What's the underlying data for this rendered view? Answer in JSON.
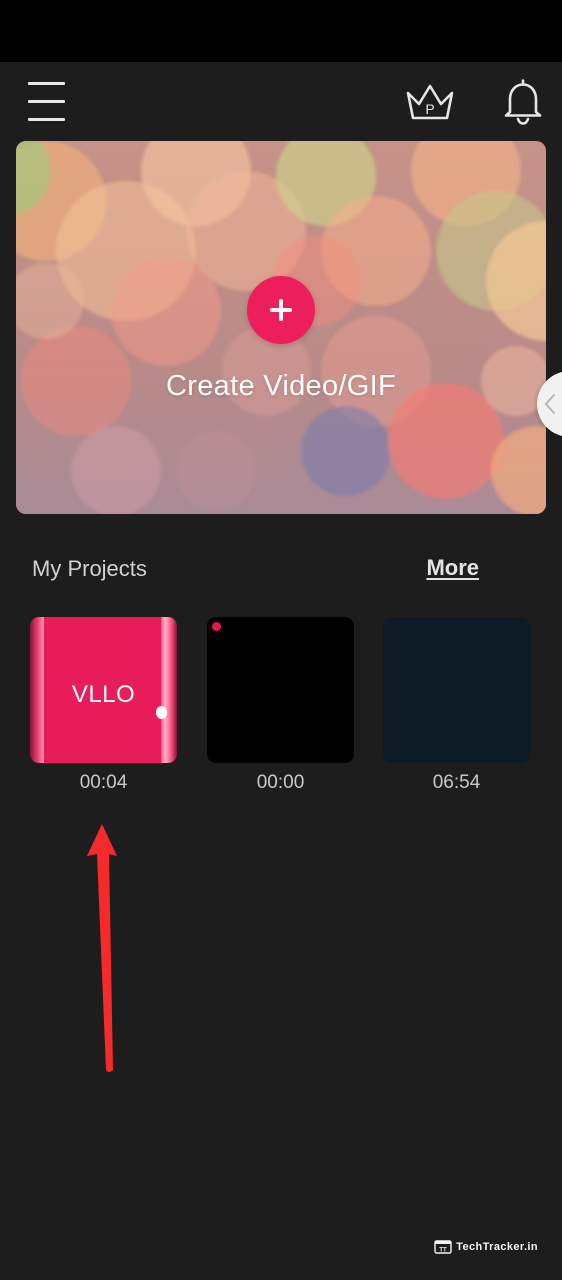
{
  "create": {
    "label": "Create Video/GIF"
  },
  "premium": {
    "badge_letter": "P"
  },
  "projects": {
    "title": "My Projects",
    "more_label": "More",
    "items": [
      {
        "thumb_text": "VLLO",
        "duration": "00:04",
        "thumb_color": "#e91c5b"
      },
      {
        "thumb_text": "",
        "duration": "00:00",
        "thumb_color": "#000000"
      },
      {
        "thumb_text": "",
        "duration": "06:54",
        "thumb_color": "#0d1b26"
      }
    ]
  },
  "watermark": {
    "text": "TechTracker.in"
  },
  "colors": {
    "background": "#1d1d1d",
    "accent": "#ec1e5c",
    "annotation_arrow": "#f52a2a"
  },
  "icons": {
    "menu": "hamburger-menu-icon",
    "premium": "crown-icon",
    "notifications": "bell-icon",
    "create": "plus-icon",
    "side_handle": "chevron-left-icon"
  }
}
